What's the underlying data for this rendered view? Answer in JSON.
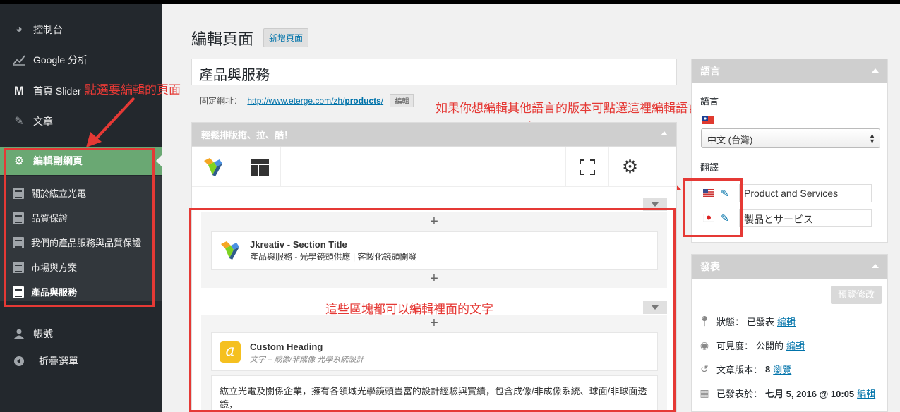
{
  "sidebar": {
    "items": [
      {
        "label": "控制台",
        "icon": "dashboard-icon"
      },
      {
        "label": "Google 分析",
        "icon": "analytics-icon"
      },
      {
        "label": "首頁 Slider",
        "icon": "slider-icon"
      },
      {
        "label": "文章",
        "icon": "pin-icon"
      },
      {
        "label": "編輯副網頁",
        "icon": "gear-icon"
      },
      {
        "label": "帳號",
        "icon": "user-icon"
      },
      {
        "label": "折疊選單",
        "icon": "collapse-icon"
      }
    ],
    "submenu": [
      "關於紘立光電",
      "品質保證",
      "我們的產品服務與品質保證",
      "市場與方案",
      "產品與服務"
    ]
  },
  "annotations": {
    "click_page": "點選要編輯的頁面",
    "other_lang": "如果你想編輯其他語言的版本可點選這裡編輯語言",
    "blocks_editable": "這些區塊都可以編輯裡面的文字"
  },
  "header": {
    "title": "編輯頁面",
    "add_new": "新增頁面"
  },
  "post": {
    "title": "產品與服務",
    "permalink_label": "固定網址：",
    "permalink_base": "http://www.eterge.com/zh/",
    "permalink_slug": "products",
    "permalink_tail": "/",
    "permalink_edit": "編輯"
  },
  "builder": {
    "header": "輕鬆排版拖、拉、酷！",
    "elements": [
      {
        "name": "Jkreativ - Section Title",
        "desc": "產品與服務 - 光學鏡頭供應 | 客製化鏡頭開發"
      },
      {
        "name": "Custom Heading",
        "desc": "文字 – 成像/非成像 光學系統設計"
      }
    ],
    "text_block": "紘立光電及關係企業，擁有各領域光學鏡頭豐富的設計經驗與實績，包含成像/非成像系統、球面/非球面透鏡，"
  },
  "language_box": {
    "title": "語言",
    "lang_label": "語言",
    "selected": "中文 (台灣)",
    "translations_label": "翻譯",
    "translations": [
      {
        "flag": "us",
        "value": "Product and Services"
      },
      {
        "flag": "jp",
        "value": "製品とサービス"
      }
    ]
  },
  "publish_box": {
    "title": "發表",
    "preview": "預覽修改",
    "status_label": "狀態：",
    "status_value": "已發表",
    "status_edit": "編輯",
    "visibility_label": "可見度：",
    "visibility_value": "公開的",
    "visibility_edit": "編輯",
    "revisions_label": "文章版本：",
    "revisions_value": "8",
    "revisions_link": "瀏覽",
    "published_label": "已發表於：",
    "published_value": "七月 5, 2016 @ 10:05",
    "published_edit": "編輯"
  },
  "colors": {
    "sidebar_bg": "#23282d",
    "active_green": "#6aa873",
    "annotation_red": "#e53935",
    "link_blue": "#0073aa"
  }
}
